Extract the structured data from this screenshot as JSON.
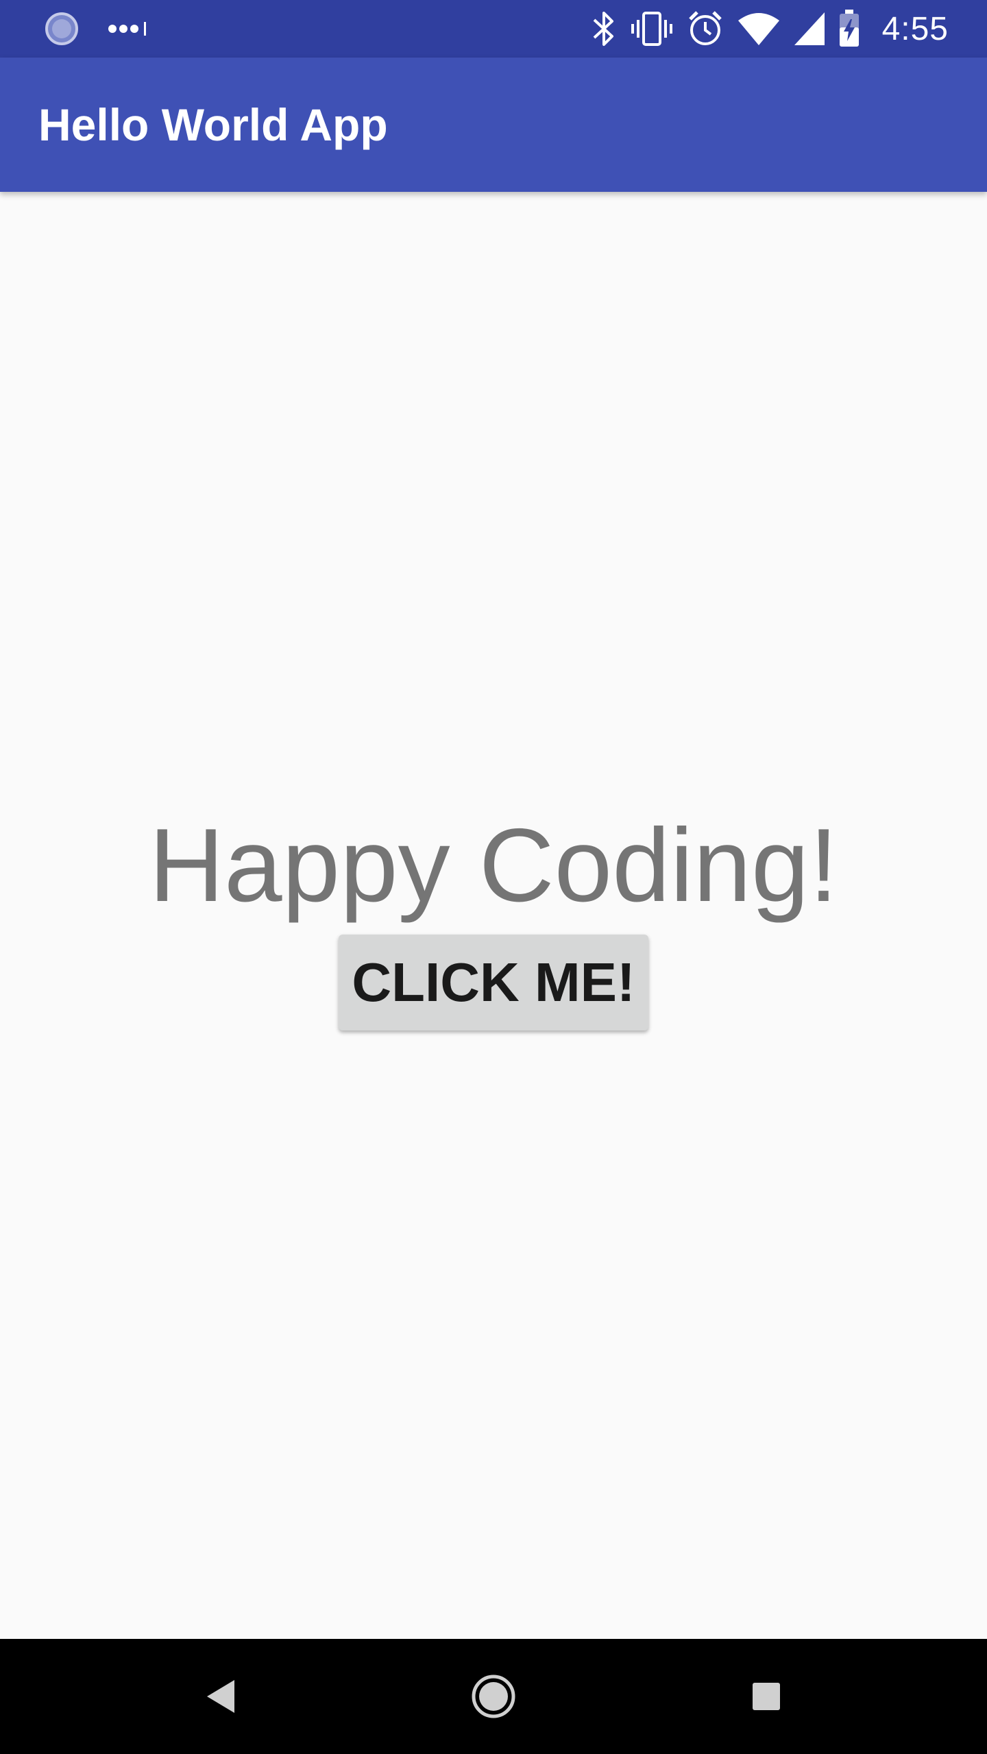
{
  "status_bar": {
    "time": "4:55",
    "icons": [
      "loading-icon",
      "more-dots-icon",
      "bluetooth-icon",
      "vibrate-icon",
      "alarm-icon",
      "wifi-icon",
      "cell-signal-icon",
      "battery-charging-icon"
    ]
  },
  "app_bar": {
    "title": "Hello World App"
  },
  "main": {
    "greeting": "Happy Coding!",
    "button_label": "CLICK ME!"
  },
  "nav_bar": {
    "icons": [
      "back-icon",
      "home-icon",
      "recents-icon"
    ]
  },
  "colors": {
    "status_bar": "#303f9f",
    "app_bar": "#3f51b5",
    "background": "#fafafa",
    "greeting_text": "#757575",
    "button_bg": "#d6d7d7",
    "nav_bar": "#000000"
  }
}
